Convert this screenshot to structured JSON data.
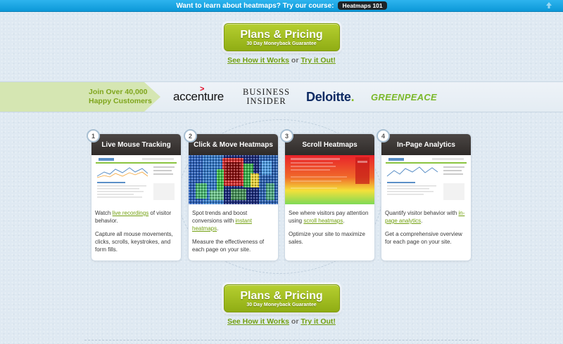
{
  "banner": {
    "text": "Want to learn about heatmaps? Try our course:",
    "course_label": "Heatmaps 101"
  },
  "cta": {
    "title": "Plans & Pricing",
    "subtitle": "30 Day Moneyback Guarantee",
    "see_how": "See How it Works",
    "or": "or",
    "try_it": "Try it Out!"
  },
  "customers": {
    "line1": "Join Over 40,000",
    "line2": "Happy Customers",
    "logos": {
      "accenture": "accenture",
      "business_insider_1": "BUSINESS",
      "business_insider_2": "INSIDER",
      "deloitte": "Deloitte",
      "deloitte_dot": ".",
      "greenpeace": "GREENPEACE"
    }
  },
  "features": [
    {
      "num": "1",
      "title": "Live Mouse Tracking",
      "p1_pre": "Watch ",
      "p1_link": "live recordings",
      "p1_post": " of visitor behavior.",
      "p2": "Capture all mouse movements, clicks, scrolls, keystrokes, and form fills."
    },
    {
      "num": "2",
      "title": "Click & Move Heatmaps",
      "p1_pre": "Spot trends and boost conversions with ",
      "p1_link": "instant heatmaps",
      "p1_post": ".",
      "p2": "Measure the effectiveness of each page on your site."
    },
    {
      "num": "3",
      "title": "Scroll Heatmaps",
      "p1_pre": "See where visitors pay attention using ",
      "p1_link": "scroll heatmaps",
      "p1_post": ".",
      "p2": "Optimize your site to maximize sales."
    },
    {
      "num": "4",
      "title": "In-Page Analytics",
      "p1_pre": "Quantify visitor behavior with ",
      "p1_link": "in-page analytics",
      "p1_post": ".",
      "p2": "Get a comprehensive overview for each page on your site."
    }
  ],
  "colors": {
    "banner": "#12a3e3",
    "accent_green": "#9bb81c",
    "link_green": "#72a010",
    "card_header": "#3a3532"
  }
}
